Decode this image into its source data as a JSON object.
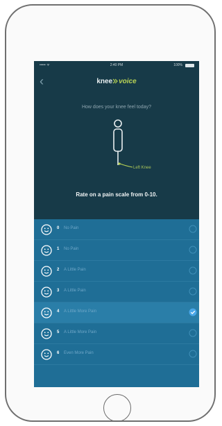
{
  "status_bar": {
    "signal": "••••• ᯤ",
    "time": "2:40 PM",
    "battery": "100%"
  },
  "header": {
    "back_icon": "chevron-left-icon",
    "logo_knee": "knee",
    "logo_voice": "voice"
  },
  "question": "How does your knee feel today?",
  "figure": {
    "knee_label": "Left Knee"
  },
  "pain_scale_title": "Rate on a pain scale from 0-10.",
  "pain_levels": [
    {
      "value": "0",
      "label": "No Pain",
      "selected": false
    },
    {
      "value": "1",
      "label": "No Pain",
      "selected": false
    },
    {
      "value": "2",
      "label": "A Little Pain",
      "selected": false
    },
    {
      "value": "3",
      "label": "A Little Pain",
      "selected": false
    },
    {
      "value": "4",
      "label": "A Little More Pain",
      "selected": true
    },
    {
      "value": "5",
      "label": "A Little More Pain",
      "selected": false
    },
    {
      "value": "6",
      "label": "Even More Pain",
      "selected": false
    }
  ],
  "colors": {
    "background": "#173a48",
    "accent": "#b8d255",
    "list": "#1f6e96",
    "check": "#4aa7e8"
  }
}
